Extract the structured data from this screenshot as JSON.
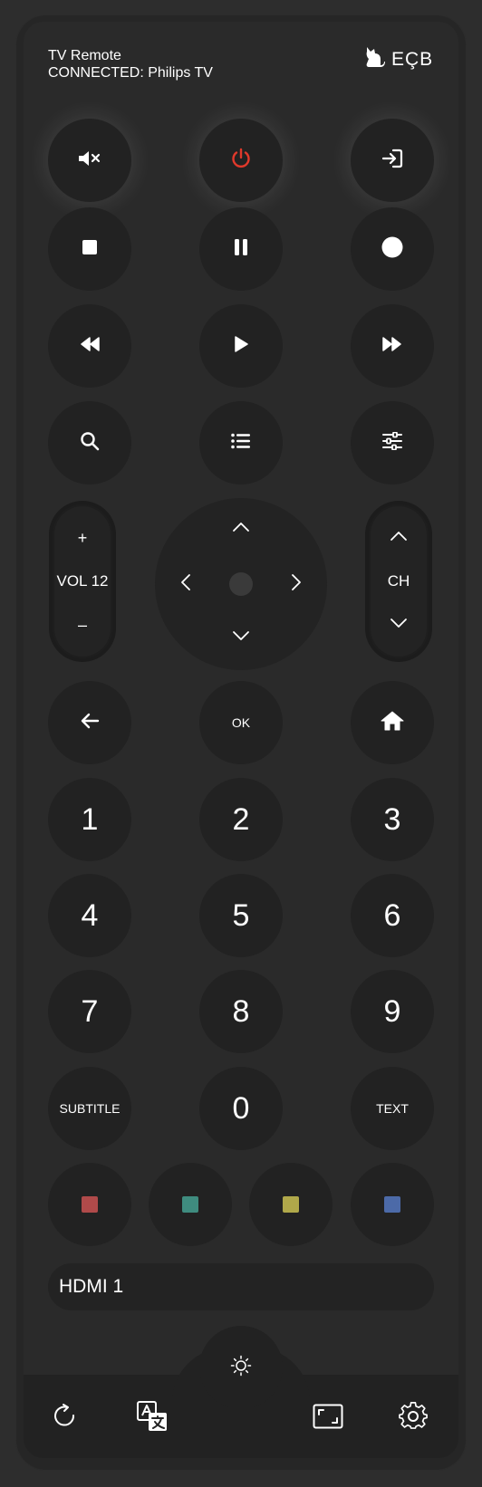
{
  "header": {
    "title": "TV Remote",
    "status": "CONNECTED: Philips TV",
    "brand_text": "EÇB",
    "brand_icon": "cat-icon"
  },
  "top_row": [
    {
      "icon": "mute-icon"
    },
    {
      "icon": "power-icon",
      "color": "#e0392b"
    },
    {
      "icon": "input-source-icon"
    }
  ],
  "media_row1": [
    {
      "icon": "stop-icon"
    },
    {
      "icon": "pause-icon"
    },
    {
      "icon": "record-icon"
    }
  ],
  "media_row2": [
    {
      "icon": "rewind-icon"
    },
    {
      "icon": "play-icon"
    },
    {
      "icon": "fast-forward-icon"
    }
  ],
  "tools_row": [
    {
      "icon": "search-icon"
    },
    {
      "icon": "list-icon"
    },
    {
      "icon": "sliders-icon"
    }
  ],
  "volume": {
    "plus": "+",
    "label": "VOL 12",
    "minus": "–"
  },
  "channel": {
    "label": "CH"
  },
  "nav_row": {
    "back_icon": "back-arrow-icon",
    "ok_label": "OK",
    "home_icon": "home-icon"
  },
  "numbers": [
    "1",
    "2",
    "3",
    "4",
    "5",
    "6",
    "7",
    "8",
    "9"
  ],
  "zero_row": {
    "subtitle": "SUBTITLE",
    "zero": "0",
    "text": "TEXT"
  },
  "color_keys": [
    {
      "name": "red",
      "color": "#b04a4a"
    },
    {
      "name": "green",
      "color": "#3f8c7f"
    },
    {
      "name": "yellow",
      "color": "#b0a84a"
    },
    {
      "name": "blue",
      "color": "#4c6aa8"
    }
  ],
  "input_source": "HDMI 1",
  "bottom_bar": [
    {
      "icon": "refresh-icon"
    },
    {
      "icon": "translate-icon"
    },
    {
      "icon": "brightness-icon"
    },
    {
      "icon": "screen-format-icon"
    },
    {
      "icon": "settings-icon"
    }
  ]
}
